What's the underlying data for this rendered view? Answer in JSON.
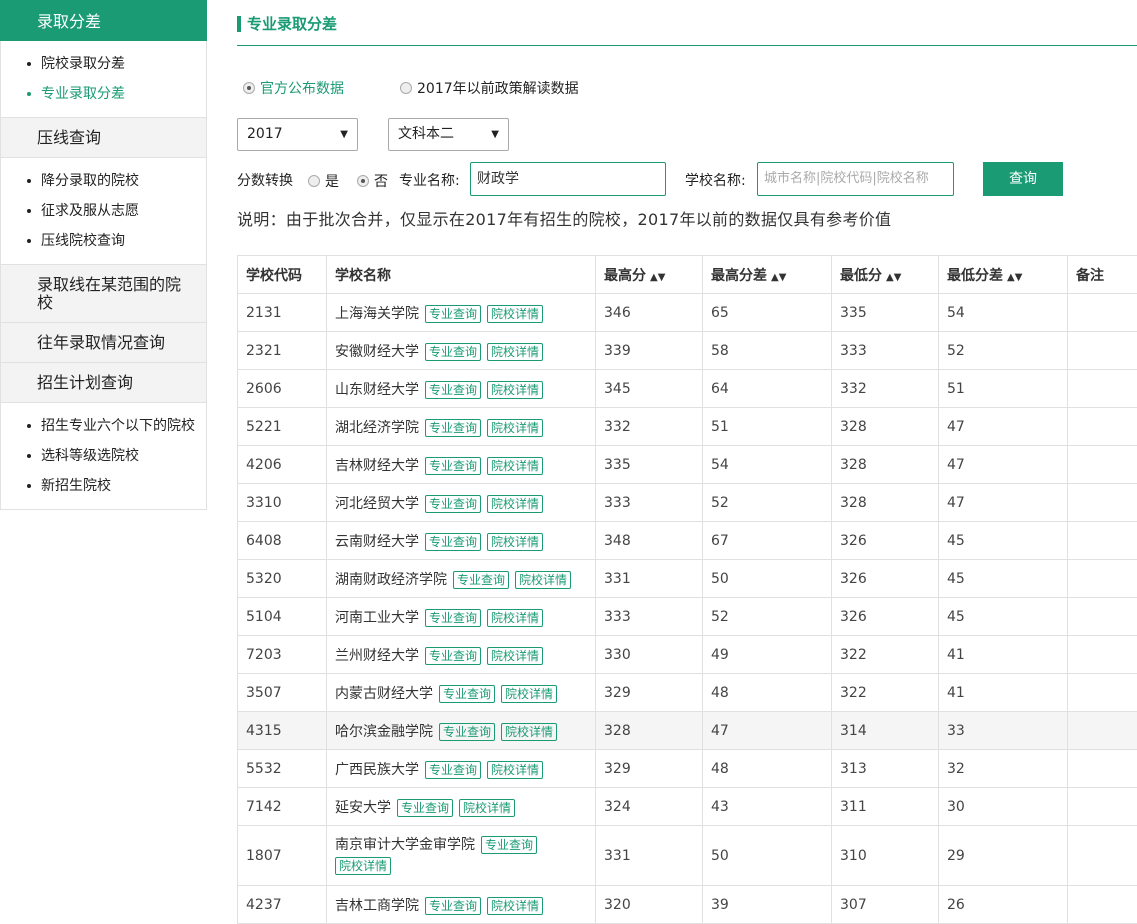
{
  "sidebar": {
    "header": "录取分差",
    "group1": [
      "院校录取分差",
      "专业录取分差"
    ],
    "sec_yaxian": "压线查询",
    "group2": [
      "降分录取的院校",
      "征求及服从志愿",
      "压线院校查询"
    ],
    "sec_fanwei": "录取线在某范围的院校",
    "sec_wangnian": "往年录取情况查询",
    "sec_zhaosheng": "招生计划查询",
    "group3": [
      "招生专业六个以下的院校",
      "选科等级选院校",
      "新招生院校"
    ]
  },
  "title": "专业录取分差",
  "data_source": {
    "official": "官方公布数据",
    "old": "2017年以前政策解读数据"
  },
  "year_select": "2017",
  "batch_select": "文科本二",
  "form": {
    "convert_label": "分数转换",
    "yes": "是",
    "no": "否",
    "major_label": "专业名称:",
    "major_value": "财政学",
    "school_label": "学校名称:",
    "school_placeholder": "城市名称|院校代码|院校名称",
    "query": "查询"
  },
  "note": "说明：由于批次合并，仅显示在2017年有招生的院校，2017年以前的数据仅具有参考价值",
  "table": {
    "headers": [
      "学校代码",
      "学校名称",
      "最高分",
      "最高分差",
      "最低分",
      "最低分差",
      "备注"
    ],
    "tag_major": "专业查询",
    "tag_detail": "院校详情",
    "rows": [
      {
        "code": "2131",
        "name": "上海海关学院",
        "max": "346",
        "max_diff": "65",
        "min": "335",
        "min_diff": "54"
      },
      {
        "code": "2321",
        "name": "安徽财经大学",
        "max": "339",
        "max_diff": "58",
        "min": "333",
        "min_diff": "52"
      },
      {
        "code": "2606",
        "name": "山东财经大学",
        "max": "345",
        "max_diff": "64",
        "min": "332",
        "min_diff": "51"
      },
      {
        "code": "5221",
        "name": "湖北经济学院",
        "max": "332",
        "max_diff": "51",
        "min": "328",
        "min_diff": "47"
      },
      {
        "code": "4206",
        "name": "吉林财经大学",
        "max": "335",
        "max_diff": "54",
        "min": "328",
        "min_diff": "47"
      },
      {
        "code": "3310",
        "name": "河北经贸大学",
        "max": "333",
        "max_diff": "52",
        "min": "328",
        "min_diff": "47"
      },
      {
        "code": "6408",
        "name": "云南财经大学",
        "max": "348",
        "max_diff": "67",
        "min": "326",
        "min_diff": "45"
      },
      {
        "code": "5320",
        "name": "湖南财政经济学院",
        "max": "331",
        "max_diff": "50",
        "min": "326",
        "min_diff": "45"
      },
      {
        "code": "5104",
        "name": "河南工业大学",
        "max": "333",
        "max_diff": "52",
        "min": "326",
        "min_diff": "45"
      },
      {
        "code": "7203",
        "name": "兰州财经大学",
        "max": "330",
        "max_diff": "49",
        "min": "322",
        "min_diff": "41"
      },
      {
        "code": "3507",
        "name": "内蒙古财经大学",
        "max": "329",
        "max_diff": "48",
        "min": "322",
        "min_diff": "41"
      },
      {
        "code": "4315",
        "name": "哈尔滨金融学院",
        "max": "328",
        "max_diff": "47",
        "min": "314",
        "min_diff": "33"
      },
      {
        "code": "5532",
        "name": "广西民族大学",
        "max": "329",
        "max_diff": "48",
        "min": "313",
        "min_diff": "32"
      },
      {
        "code": "7142",
        "name": "延安大学",
        "max": "324",
        "max_diff": "43",
        "min": "311",
        "min_diff": "30"
      },
      {
        "code": "1807",
        "name": "南京审计大学金审学院",
        "max": "331",
        "max_diff": "50",
        "min": "310",
        "min_diff": "29"
      },
      {
        "code": "4237",
        "name": "吉林工商学院",
        "max": "320",
        "max_diff": "39",
        "min": "307",
        "min_diff": "26"
      }
    ]
  },
  "colors": {
    "accent": "#1a9b73",
    "highlight_row": "#f5f5f5"
  }
}
